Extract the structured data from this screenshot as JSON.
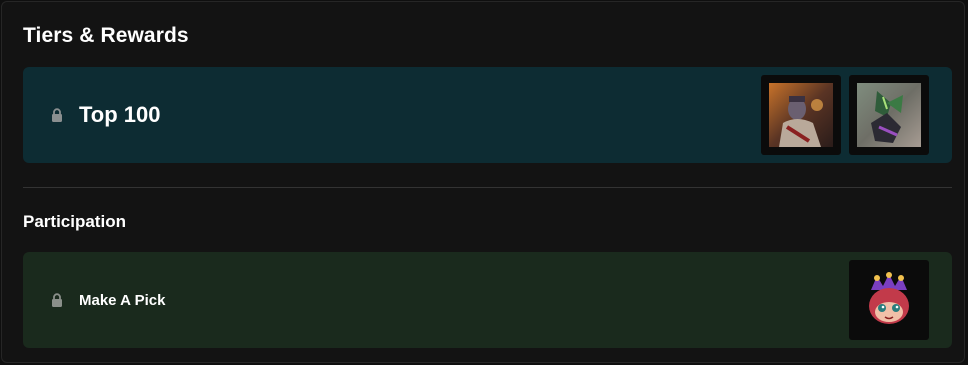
{
  "heading": "Tiers & Rewards",
  "tiers": [
    {
      "label": "Top 100",
      "locked": true,
      "rewards": [
        "champion-portrait-icon",
        "champion-portrait-icon"
      ]
    }
  ],
  "participation": {
    "title": "Participation",
    "tiers": [
      {
        "label": "Make A Pick",
        "locked": true,
        "rewards": [
          "pet-emote-icon"
        ]
      }
    ]
  },
  "colors": {
    "top_tier_bg": "#0d2c33",
    "participation_bg": "#1a2a1d",
    "panel_bg": "#131313"
  }
}
